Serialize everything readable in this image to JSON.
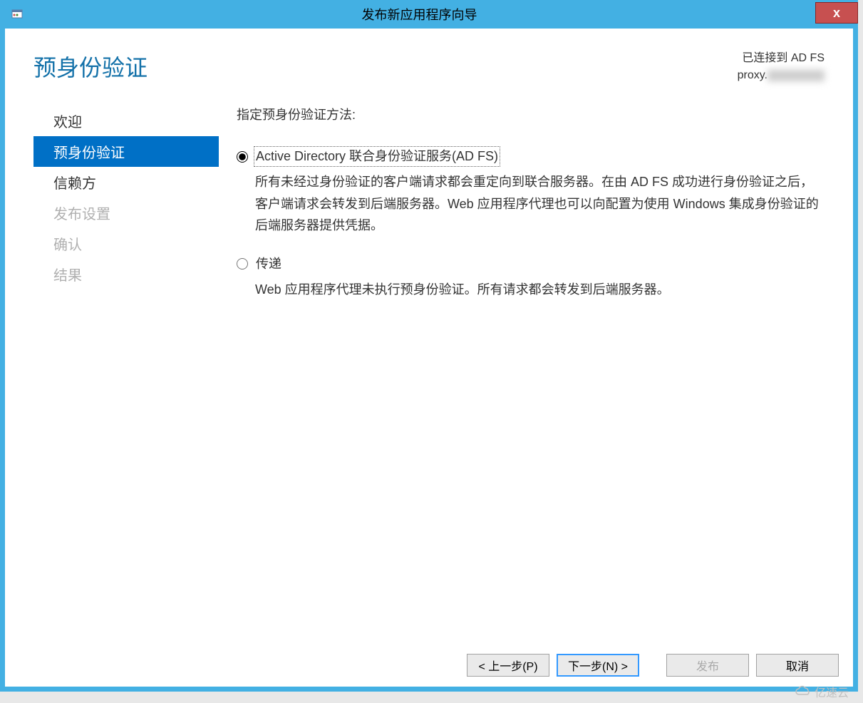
{
  "titlebar": {
    "title": "发布新应用程序向导",
    "close_icon": "x"
  },
  "header": {
    "page_title": "预身份验证",
    "connection": {
      "line1": "已连接到 AD FS",
      "line2_prefix": "proxy."
    }
  },
  "sidebar": {
    "steps": [
      {
        "label": "欢迎",
        "state": "enabled"
      },
      {
        "label": "预身份验证",
        "state": "selected"
      },
      {
        "label": "信赖方",
        "state": "enabled"
      },
      {
        "label": "发布设置",
        "state": "disabled"
      },
      {
        "label": "确认",
        "state": "disabled"
      },
      {
        "label": "结果",
        "state": "disabled"
      }
    ]
  },
  "content": {
    "instruction": "指定预身份验证方法:",
    "options": [
      {
        "value": "adfs",
        "label": "Active Directory 联合身份验证服务(AD FS)",
        "selected": true,
        "description": "所有未经过身份验证的客户端请求都会重定向到联合服务器。在由 AD FS 成功进行身份验证之后，客户端请求会转发到后端服务器。Web 应用程序代理也可以向配置为使用 Windows 集成身份验证的后端服务器提供凭据。"
      },
      {
        "value": "passthrough",
        "label": "传递",
        "selected": false,
        "description": "Web 应用程序代理未执行预身份验证。所有请求都会转发到后端服务器。"
      }
    ]
  },
  "footer": {
    "back": "< 上一步(P)",
    "next": "下一步(N) >",
    "publish": "发布",
    "cancel": "取消"
  },
  "watermark": "亿速云"
}
